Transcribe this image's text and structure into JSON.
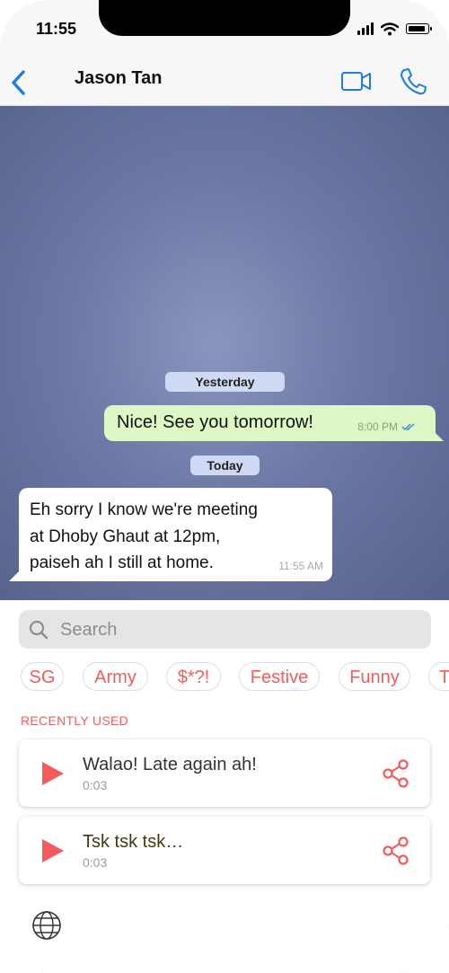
{
  "status_bar": {
    "time": "11:55",
    "battery_level": 0.9,
    "icons": [
      "cellular-signal-icon",
      "wifi-icon",
      "battery-icon"
    ]
  },
  "nav": {
    "back_icon": "chevron-left-icon",
    "contact_name": "Jason Tan",
    "actions": [
      "video-camera-icon",
      "phone-icon"
    ],
    "accent_color": "#1a7fe0"
  },
  "chat": {
    "date_labels": {
      "yesterday": "Yesterday",
      "today": "Today"
    },
    "outgoing_message": {
      "text": "Nice! See you tomorrow!",
      "time": "8:00 PM",
      "read_icon": "double-check-icon"
    },
    "incoming_message": {
      "lines": [
        "Eh sorry I know we're meeting",
        "at Dhoby Ghaut at 12pm,",
        "paiseh ah I still at home."
      ],
      "time": "11:55 AM"
    }
  },
  "sound_panel": {
    "search_placeholder": "Search",
    "categories": [
      "SG",
      "Army",
      "$*?!",
      "Festive",
      "Funny",
      "T"
    ],
    "section_title": "RECENTLY USED",
    "sounds": [
      {
        "title": "Walao! Late again ah!",
        "duration": "0:03",
        "title_color": "#333333"
      },
      {
        "title": "Tsk tsk tsk…",
        "duration": "0:03",
        "title_color": "#3f3b14"
      }
    ],
    "accent_color": "#f25c5c",
    "keyboard_switch_icon": "globe-icon"
  }
}
